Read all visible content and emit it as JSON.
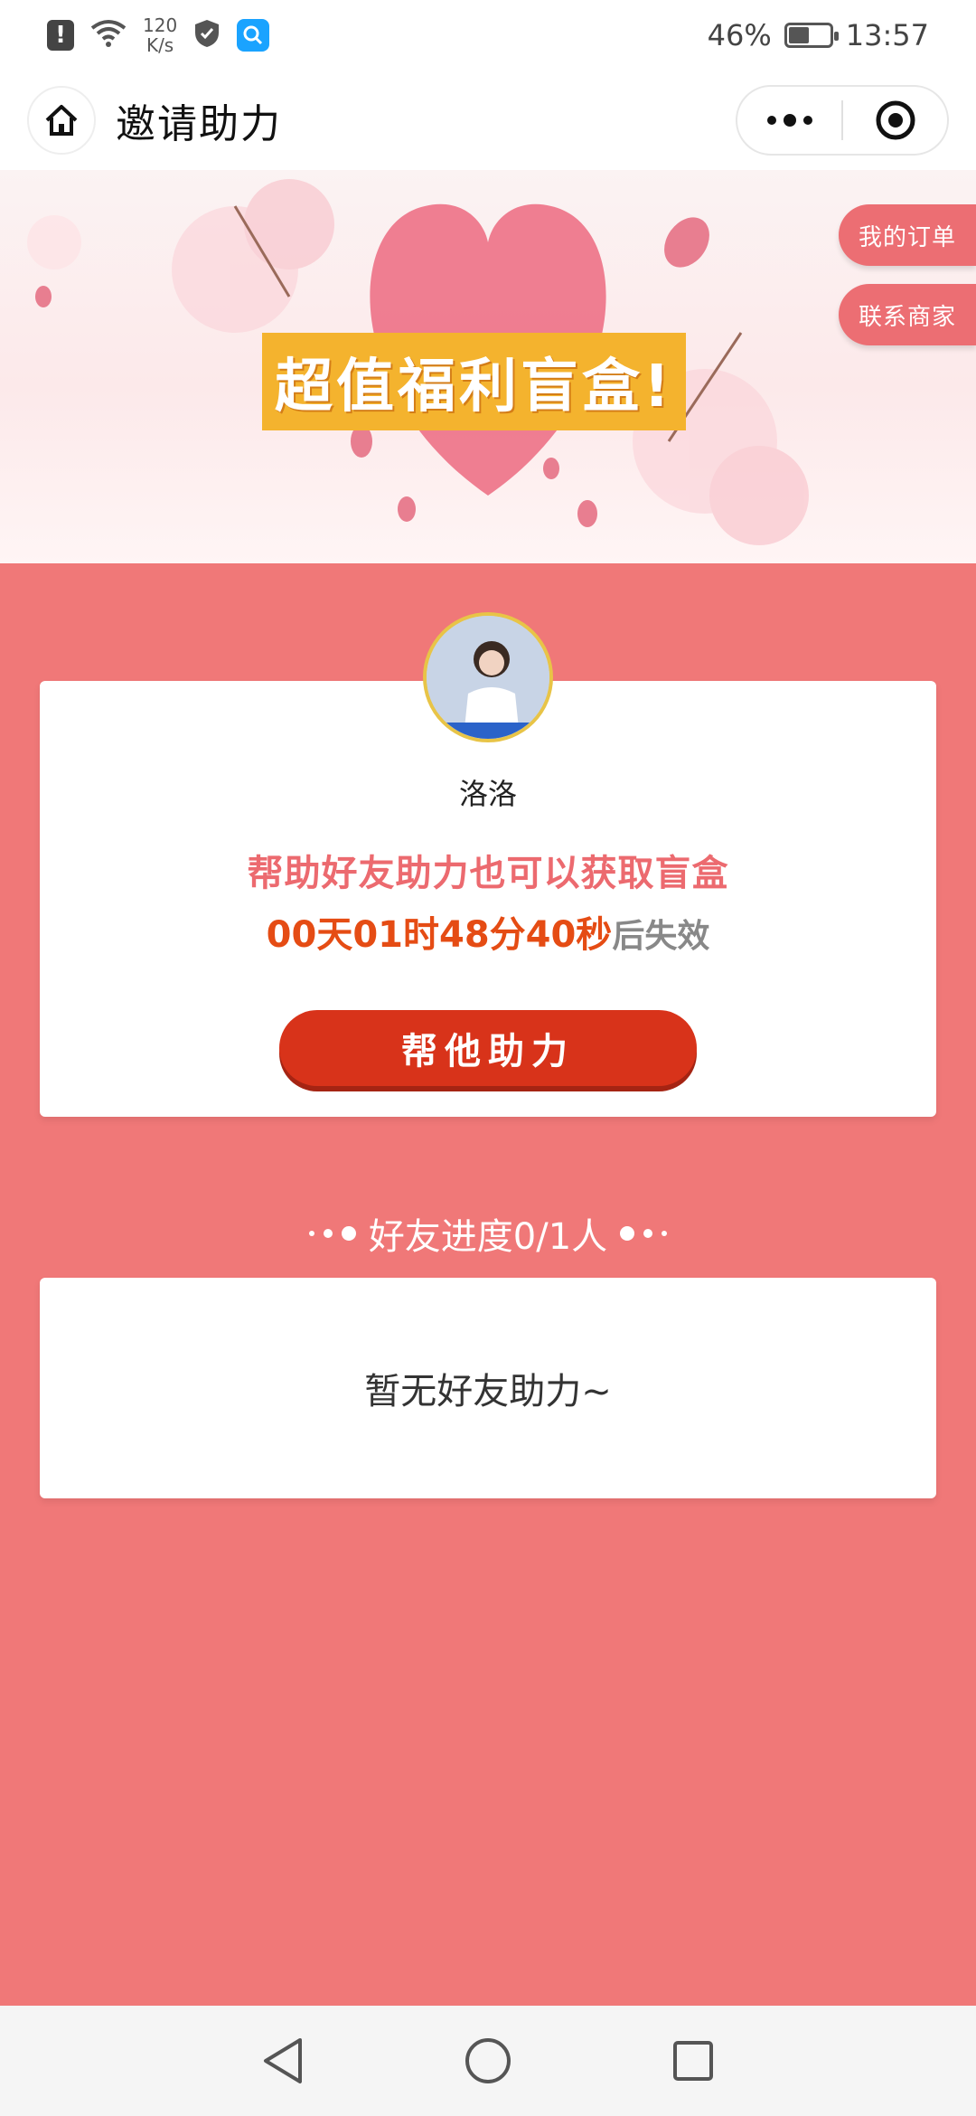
{
  "status_bar": {
    "net_speed_value": "120",
    "net_speed_unit": "K/s",
    "battery_percent": "46%",
    "time": "13:57",
    "icons": [
      "alert-icon",
      "wifi-icon",
      "shield-icon",
      "search-app-icon",
      "battery-icon"
    ]
  },
  "header": {
    "title": "邀请助力",
    "home_icon": "home-icon",
    "more_icon": "more-dots-icon",
    "close_icon": "target-close-icon"
  },
  "banner": {
    "title": "超值福利盲盒!",
    "side_tabs": [
      "我的订单",
      "联系商家"
    ]
  },
  "invite_card": {
    "nickname": "洛洛",
    "promo_text": "帮助好友助力也可以获取盲盒",
    "countdown": "00天01时48分40秒",
    "countdown_suffix": "后失效",
    "help_button": "帮他助力"
  },
  "progress": {
    "title": "好友进度0/1人",
    "helped": 0,
    "required": 1
  },
  "friends_list": {
    "empty_text": "暂无好友助力~"
  },
  "colors": {
    "page_bg": "#f07878",
    "accent": "#ec6a6f",
    "button": "#d8331a",
    "countdown": "#e54c14",
    "banner_badge": "#f4b32e"
  }
}
